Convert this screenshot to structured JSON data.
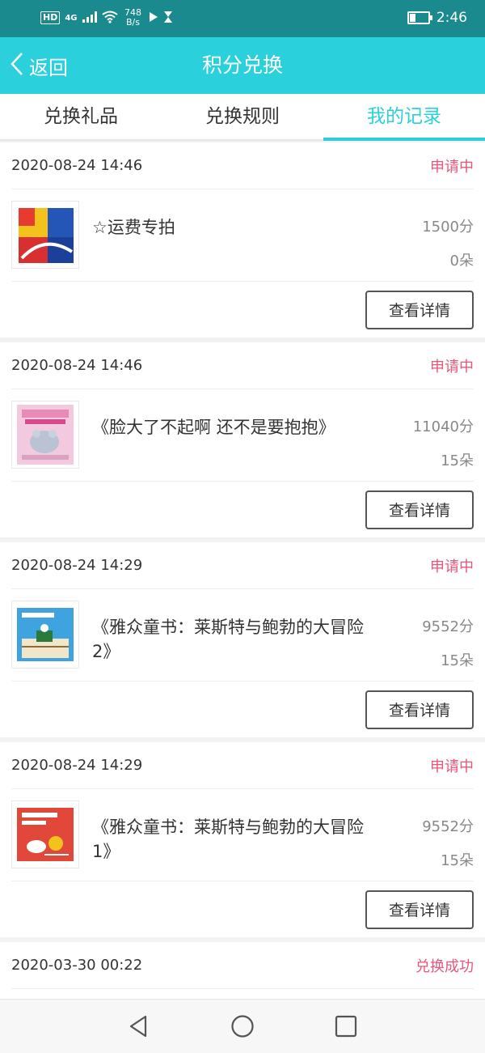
{
  "status_bar": {
    "hd": "HD",
    "network": "4G",
    "speed_value": "748",
    "speed_unit": "B/s",
    "time": "2:46"
  },
  "header": {
    "back_label": "返回",
    "title": "积分兑换"
  },
  "tabs": [
    {
      "label": "兑换礼品",
      "active": false
    },
    {
      "label": "兑换规则",
      "active": false
    },
    {
      "label": "我的记录",
      "active": true
    }
  ],
  "records": [
    {
      "date": "2020-08-24 14:46",
      "status": "申请中",
      "name": "☆运费专拍",
      "points": "1500分",
      "flowers": "0朵",
      "button": "查看详情"
    },
    {
      "date": "2020-08-24 14:46",
      "status": "申请中",
      "name": "《脸大了不起啊 还不是要抱抱》",
      "points": "11040分",
      "flowers": "15朵",
      "button": "查看详情"
    },
    {
      "date": "2020-08-24 14:29",
      "status": "申请中",
      "name": "《雅众童书：莱斯特与鲍勃的大冒险2》",
      "points": "9552分",
      "flowers": "15朵",
      "button": "查看详情"
    },
    {
      "date": "2020-08-24 14:29",
      "status": "申请中",
      "name": "《雅众童书：莱斯特与鲍勃的大冒险1》",
      "points": "9552分",
      "flowers": "15朵",
      "button": "查看详情"
    },
    {
      "date": "2020-03-30 00:22",
      "status": "兑换成功"
    }
  ],
  "colors": {
    "accent": "#2ad0dc",
    "status_bar": "#1b8a8f",
    "pending": "#e8567a"
  }
}
